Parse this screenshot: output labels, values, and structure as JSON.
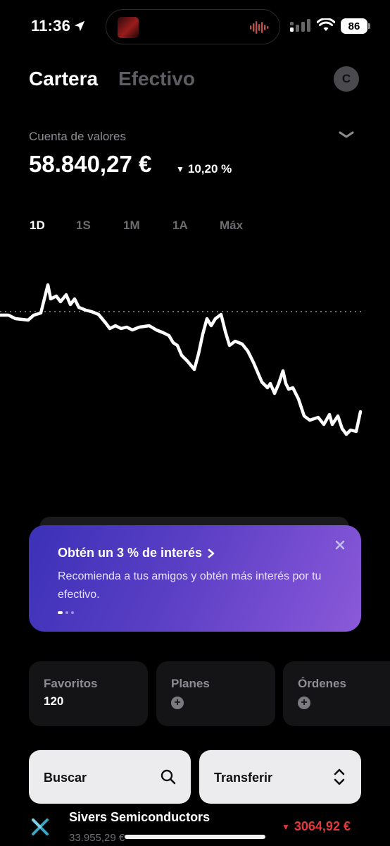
{
  "status_bar": {
    "time": "11:36",
    "battery": "86"
  },
  "header": {
    "tabs": [
      "Cartera",
      "Efectivo"
    ],
    "avatar_initial": "C"
  },
  "account": {
    "label": "Cuenta de valores",
    "balance": "58.840,27 €",
    "change": "10,20 %"
  },
  "periods": [
    "1D",
    "1S",
    "1M",
    "1A",
    "Máx"
  ],
  "promo": {
    "title": "Obtén un 3 % de interés",
    "body": "Recomienda a tus amigos y obtén más interés por tu efectivo.",
    "slide_count": 3,
    "active_slide": 1
  },
  "tiles": [
    {
      "label": "Favoritos",
      "value": "120"
    },
    {
      "label": "Planes"
    },
    {
      "label": "Órdenes"
    }
  ],
  "actions": {
    "search_label": "Buscar",
    "transfer_label": "Transferir"
  },
  "holding": {
    "name": "Sivers Semiconductors",
    "subtitle": "33.955,29 €",
    "price": "3064,92 €"
  },
  "colors": {
    "negative": "#e23a3a",
    "promo_start": "#3b31b8",
    "promo_end": "#8a5ad8"
  }
}
